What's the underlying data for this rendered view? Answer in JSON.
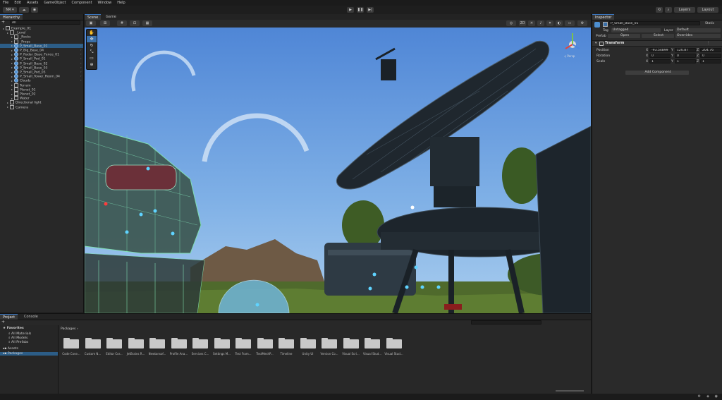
{
  "menu": [
    "File",
    "Edit",
    "Assets",
    "GameObject",
    "Component",
    "Window",
    "Help"
  ],
  "toolbar": {
    "account": "NR ▾",
    "layers": "Layers",
    "layout": "Layout"
  },
  "hierarchy": {
    "tab": "Hierarchy",
    "search_placeholder": "All",
    "items": [
      {
        "label": "Example_01",
        "indent": 0,
        "sel": false,
        "plain": true
      },
      {
        "label": "_Level",
        "indent": 1,
        "sel": false,
        "plain": true
      },
      {
        "label": "_Rocks",
        "indent": 2,
        "sel": false,
        "plain": true
      },
      {
        "label": "_Props",
        "indent": 2,
        "sel": false,
        "plain": true
      },
      {
        "label": "P_Small_Base_01",
        "indent": 2,
        "sel": true,
        "plain": false
      },
      {
        "label": "P_Big_Base_04",
        "indent": 2,
        "sel": false,
        "plain": false
      },
      {
        "label": "P_Radar_Base_Fence_01",
        "indent": 2,
        "sel": false,
        "plain": false
      },
      {
        "label": "P_Small_Pod_01",
        "indent": 2,
        "sel": false,
        "plain": false
      },
      {
        "label": "P_Small_Base_02",
        "indent": 2,
        "sel": false,
        "plain": false
      },
      {
        "label": "P_Small_Base_03",
        "indent": 2,
        "sel": false,
        "plain": false
      },
      {
        "label": "P_Small_Pod_03",
        "indent": 2,
        "sel": false,
        "plain": false
      },
      {
        "label": "P_Small_Tower_Room_04",
        "indent": 2,
        "sel": false,
        "plain": false
      },
      {
        "label": "Clouds",
        "indent": 2,
        "sel": false,
        "plain": false
      },
      {
        "label": "Terrain",
        "indent": 2,
        "sel": false,
        "plain": true
      },
      {
        "label": "Planet_01",
        "indent": 2,
        "sel": false,
        "plain": true
      },
      {
        "label": "Planet_02",
        "indent": 2,
        "sel": false,
        "plain": true
      },
      {
        "label": "Water",
        "indent": 2,
        "sel": false,
        "plain": true
      },
      {
        "label": "Directional light",
        "indent": 1,
        "sel": false,
        "plain": true
      },
      {
        "label": "Camera",
        "indent": 1,
        "sel": false,
        "plain": true
      }
    ]
  },
  "scene": {
    "tabs": [
      "Scene",
      "Game"
    ],
    "persp_label": "◁ Persp"
  },
  "inspector": {
    "tab": "Inspector",
    "object_name": "P_Small_Base_01",
    "static_label": "Static",
    "tag_label": "Tag",
    "tag_value": "Untagged",
    "layer_label": "Layer",
    "layer_value": "Default",
    "prefab_label": "Prefab",
    "open_button": "Open",
    "select_button": "Select",
    "overrides": "Overrides",
    "transform_title": "Transform",
    "position_label": "Position",
    "rotation_label": "Rotation",
    "scale_label": "Scale",
    "position": {
      "x": "-93.54899",
      "y": "120.87",
      "z": "204.76"
    },
    "rotation": {
      "x": "0",
      "y": "0",
      "z": "0"
    },
    "scale": {
      "x": "1",
      "y": "1",
      "z": "1"
    },
    "add_component": "Add Component"
  },
  "project": {
    "tabs": [
      "Project",
      "Console"
    ],
    "favorites_label": "Favorites",
    "favorites": [
      "All Materials",
      "All Models",
      "All Prefabs"
    ],
    "assets_label": "Assets",
    "packages_label": "Packages",
    "breadcrumb": "Packages",
    "folders": [
      "Code Cove...",
      "Custom N...",
      "Editor Cor...",
      "JetBrains R...",
      "Newtonsof...",
      "Profile Ana...",
      "Services C...",
      "Settings M...",
      "Test Fram...",
      "TextMeshP...",
      "Timeline",
      "Unity UI",
      "Version Co...",
      "Visual Scri...",
      "Visual Stud...",
      "Visual Stud..."
    ]
  },
  "colors": {
    "accent": "#3b78c4",
    "selection": "#2c5d87",
    "sky": "#5c8fd6",
    "wire": "#7fe0b0"
  }
}
